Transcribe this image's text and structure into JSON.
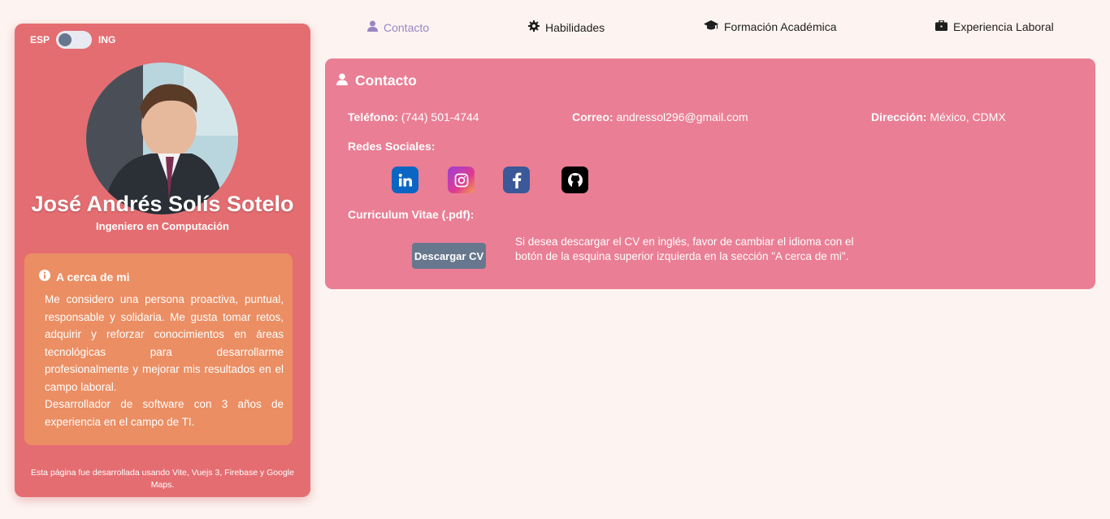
{
  "sidebar": {
    "lang_left": "ESP",
    "lang_right": "ING",
    "name": "José Andrés Solís Sotelo",
    "role": "Ingeniero en Computación",
    "about_title": "A cerca de mi",
    "about_p1": "Me considero una persona proactiva, puntual, responsable y solidaria. Me gusta tomar retos, adquirir y reforzar conocimientos en áreas tecnológicas para desarrollarme profesionalmente y mejorar mis resultados en el campo laboral.",
    "about_p2": "Desarrollador de software con 3 años de experiencia en el campo de TI.",
    "footer": "Esta página fue desarrollada usando Vite, Vuejs 3, Firebase y Google Maps."
  },
  "nav": {
    "contact": "Contacto",
    "skills": "Habilidades",
    "education": "Formación Académica",
    "experience": "Experiencia Laboral"
  },
  "contact": {
    "title": "Contacto",
    "phone_label": "Teléfono:",
    "phone_value": "(744) 501-4744",
    "email_label": "Correo:",
    "email_value": "andressol296@gmail.com",
    "address_label": "Dirección:",
    "address_value": "México, CDMX",
    "social_label": "Redes Sociales:",
    "cv_label": "Curriculum Vitae (.pdf):",
    "cv_button": "Descargar CV",
    "cv_note": "Si desea descargar el CV en inglés, favor de cambiar el idioma con el botón de la esquina superior izquierda en la sección \"A cerca de mi\"."
  },
  "colors": {
    "sidebar": "#e46d71",
    "about_box": "#eb8e63",
    "card": "#ea7e95",
    "nav_active": "#9a84c4",
    "button": "#67778e",
    "linkedin": "#0a66c2",
    "facebook": "#3b5998",
    "github": "#000000"
  },
  "icons": [
    "user-icon",
    "gear-icon",
    "graduation-cap-icon",
    "briefcase-icon",
    "info-icon",
    "linkedin-icon",
    "instagram-icon",
    "facebook-icon",
    "github-icon"
  ]
}
